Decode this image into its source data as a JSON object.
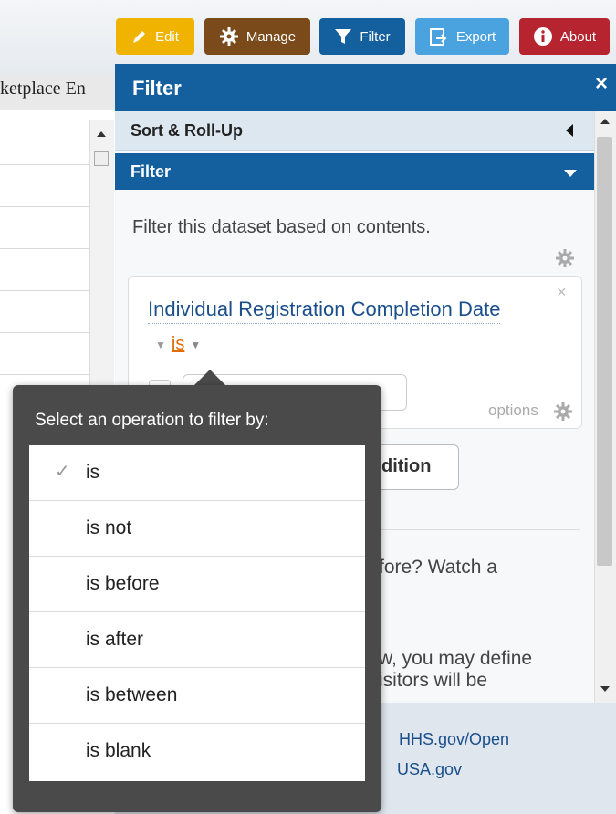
{
  "toolbar": {
    "buttons": [
      {
        "label": "Edit",
        "icon": "pencil-icon",
        "color": "#f0b400"
      },
      {
        "label": "Manage",
        "icon": "gear-icon",
        "color": "#7a4a1a"
      },
      {
        "label": "Filter",
        "icon": "filter-icon",
        "color": "#145f9e"
      },
      {
        "label": "Export",
        "icon": "export-icon",
        "color": "#4aa3df"
      },
      {
        "label": "About",
        "icon": "info-icon",
        "color": "#b5242f"
      }
    ]
  },
  "left_grid": {
    "header_text": "ketplace En"
  },
  "panel": {
    "title": "Filter",
    "close": "×",
    "sort_section": "Sort & Roll-Up",
    "filter_section": "Filter",
    "description": "Filter this dataset based on contents.",
    "condition": {
      "column": "Individual Registration Completion Date",
      "operator": "is",
      "options_label": "options",
      "close": "×"
    },
    "add_condition_label": "dition",
    "help_text_1": "fore? Watch a",
    "help_text_2": "w, you may define",
    "help_text_3": "isitors will be"
  },
  "footer": {
    "links": [
      "HHS.gov/Open",
      "USA.gov"
    ]
  },
  "popup": {
    "title": "Select an operation to filter by:",
    "options": [
      {
        "label": "is",
        "selected": true
      },
      {
        "label": "is not",
        "selected": false
      },
      {
        "label": "is before",
        "selected": false
      },
      {
        "label": "is after",
        "selected": false
      },
      {
        "label": "is between",
        "selected": false
      },
      {
        "label": "is blank",
        "selected": false
      }
    ],
    "check_glyph": "✓"
  }
}
